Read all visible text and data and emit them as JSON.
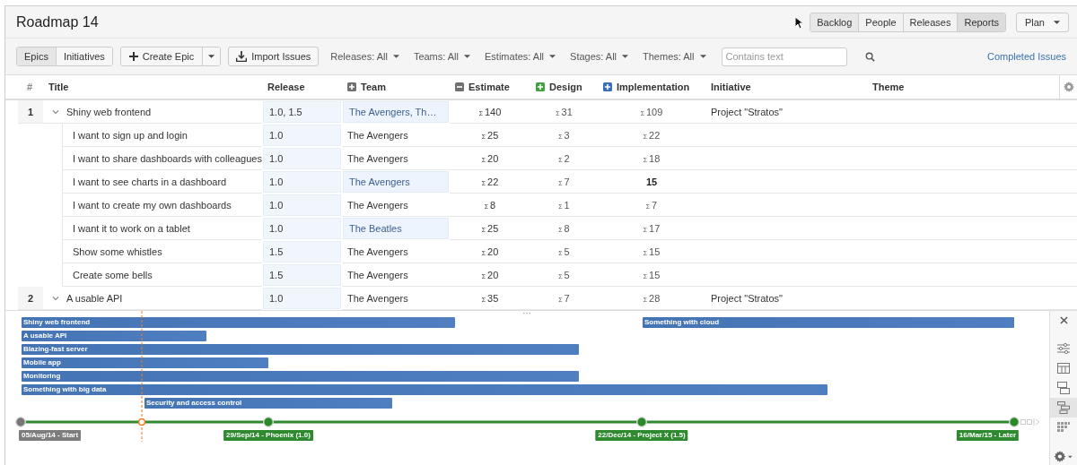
{
  "page_title": "Roadmap 14",
  "nav": [
    {
      "label": "Backlog",
      "selected": false
    },
    {
      "label": "People",
      "selected": false
    },
    {
      "label": "Releases",
      "selected": false
    },
    {
      "label": "Reports",
      "selected": true
    }
  ],
  "plan_menu": "Plan",
  "toolbar": {
    "views": [
      {
        "label": "Epics",
        "selected": true
      },
      {
        "label": "Initiatives",
        "selected": false
      }
    ],
    "create": "Create Epic",
    "import": "Import Issues",
    "filters": [
      "Releases: All",
      "Teams: All",
      "Estimates: All",
      "Stages: All",
      "Themes: All"
    ],
    "search": {
      "placeholder": "Contains text"
    },
    "completed_link": "Completed Issues"
  },
  "columns": [
    {
      "label": "#"
    },
    {
      "label": "Title"
    },
    {
      "label": "Release"
    },
    {
      "label": "Team",
      "expanded": false,
      "color": "#707070"
    },
    {
      "label": "Estimate",
      "expanded": true,
      "color": "#707070"
    },
    {
      "label": "Design",
      "expanded": false,
      "color": "#3fa33f"
    },
    {
      "label": "Implementation",
      "expanded": false,
      "color": "#3b6fb6"
    },
    {
      "label": "Initiative"
    },
    {
      "label": "Theme"
    }
  ],
  "rows": [
    {
      "num": "1",
      "title": "Shiny web frontend",
      "expanded": true,
      "release": "1.0, 1.5",
      "team": "The Avengers, Th…",
      "team_highlighted": true,
      "estimate": {
        "sum": "Σ",
        "value": "140"
      },
      "design": {
        "sum": "Σ",
        "value": "31"
      },
      "implementation": {
        "sum": "Σ",
        "value": "109"
      },
      "initiative": "Project \"Stratos\"",
      "children": [
        {
          "title": "I want to sign up and login",
          "release": "1.0",
          "team": "The Avengers",
          "team_highlighted": false,
          "estimate": {
            "sum": "Σ",
            "value": "25"
          },
          "design": {
            "sum": "Σ",
            "value": "3"
          },
          "implementation": {
            "sum": "Σ",
            "value": "22"
          }
        },
        {
          "title": "I want to share dashboards with colleagues",
          "release": "1.0",
          "team": "The Avengers",
          "team_highlighted": false,
          "estimate": {
            "sum": "Σ",
            "value": "20"
          },
          "design": {
            "sum": "Σ",
            "value": "2"
          },
          "implementation": {
            "sum": "Σ",
            "value": "18"
          }
        },
        {
          "title": "I want to see charts in a dashboard",
          "release": "1.0",
          "team": "The Avengers",
          "team_highlighted": true,
          "estimate": {
            "sum": "Σ",
            "value": "22"
          },
          "design": {
            "sum": "Σ",
            "value": "7"
          },
          "implementation": {
            "value": "15"
          }
        },
        {
          "title": "I want to create my own dashboards",
          "release": "1.0",
          "team": "The Avengers",
          "team_highlighted": false,
          "estimate": {
            "sum": "Σ",
            "value": "8"
          },
          "design": {
            "sum": "Σ",
            "value": "1"
          },
          "implementation": {
            "sum": "Σ",
            "value": "7"
          }
        },
        {
          "title": "I want it to work on a tablet",
          "release": "1.0",
          "team": "The Beatles",
          "team_highlighted": true,
          "estimate": {
            "sum": "Σ",
            "value": "25"
          },
          "design": {
            "sum": "Σ",
            "value": "8"
          },
          "implementation": {
            "sum": "Σ",
            "value": "17"
          }
        },
        {
          "title": "Show some whistles",
          "release": "1.5",
          "team": "The Avengers",
          "team_highlighted": false,
          "estimate": {
            "sum": "Σ",
            "value": "20"
          },
          "design": {
            "sum": "Σ",
            "value": "5"
          },
          "implementation": {
            "sum": "Σ",
            "value": "15"
          }
        },
        {
          "title": "Create some bells",
          "release": "1.5",
          "team": "The Avengers",
          "team_highlighted": false,
          "estimate": {
            "sum": "Σ",
            "value": "20"
          },
          "design": {
            "sum": "Σ",
            "value": "5"
          },
          "implementation": {
            "sum": "Σ",
            "value": "15"
          }
        }
      ]
    },
    {
      "num": "2",
      "title": "A usable API",
      "expanded": true,
      "release": "1.0",
      "team": "The Avengers",
      "team_highlighted": false,
      "estimate": {
        "sum": "Σ",
        "value": "35"
      },
      "design": {
        "sum": "Σ",
        "value": "7"
      },
      "implementation": {
        "sum": "Σ",
        "value": "28"
      },
      "initiative": "Project \"Stratos\""
    }
  ],
  "timeline": {
    "bars": [
      {
        "label": "Shiny web frontend"
      },
      {
        "label": "Something with cloud"
      },
      {
        "label": "A usable API"
      },
      {
        "label": "Blazing-fast server"
      },
      {
        "label": "Mobile app"
      },
      {
        "label": "Monitoring"
      },
      {
        "label": "Something with big data"
      },
      {
        "label": "Security and access control"
      }
    ],
    "milestones": [
      {
        "label": "05/Aug/14 - Start",
        "kind": "start"
      },
      {
        "label": "29/Sep/14 - Phoenix (1.0)",
        "kind": "release"
      },
      {
        "label": "22/Dec/14 - Project X (1.5)",
        "kind": "release"
      },
      {
        "label": "16/Mar/15 - Later",
        "kind": "release"
      }
    ],
    "view_buttons": [
      {
        "selected": false
      },
      {
        "selected": false
      },
      {
        "selected": false
      },
      {
        "selected": true
      },
      {
        "selected": false
      }
    ]
  }
}
